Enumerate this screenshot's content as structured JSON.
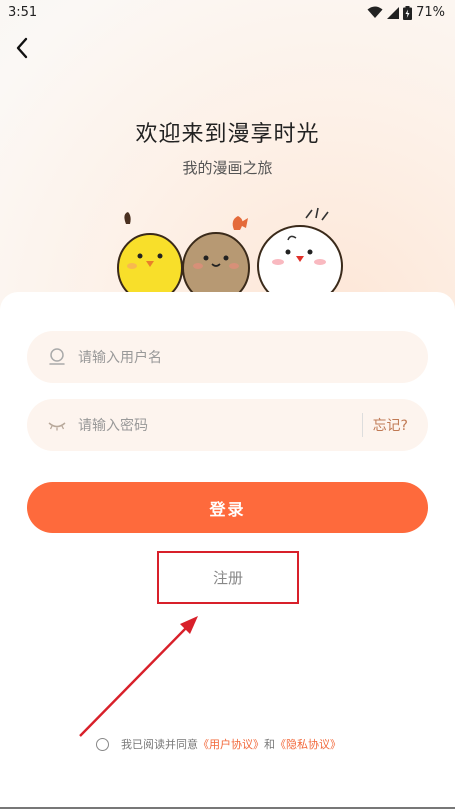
{
  "status_bar": {
    "time": "3:51",
    "battery": "71%"
  },
  "header": {
    "title": "欢迎来到漫享时光",
    "subtitle": "我的漫画之旅"
  },
  "form": {
    "username_placeholder": "请输入用户名",
    "password_placeholder": "请输入密码",
    "forgot_label": "忘记?",
    "login_label": "登录",
    "register_label": "注册"
  },
  "agreement": {
    "prefix": "我已阅读并同意",
    "user_agreement": "《用户协议》",
    "and": "和",
    "privacy_agreement": "《隐私协议》"
  },
  "colors": {
    "accent": "#fe6a3c",
    "annotation": "#d8202a",
    "field_bg": "#fdf4ee"
  }
}
